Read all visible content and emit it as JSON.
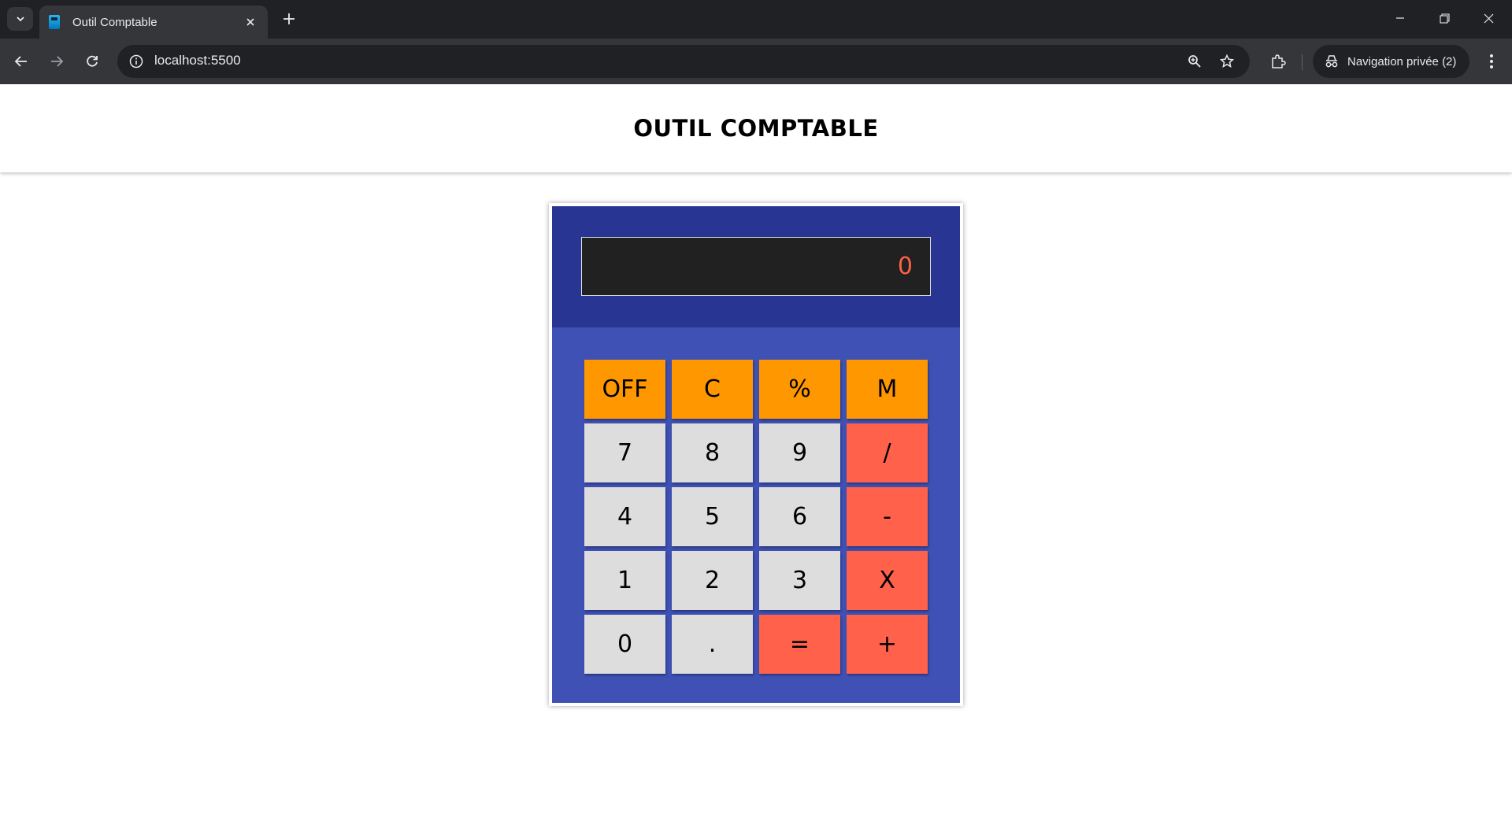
{
  "browser": {
    "tab_title": "Outil Comptable",
    "url": "localhost:5500",
    "private_label": "Navigation privée (2)"
  },
  "page": {
    "title": "OUTIL COMPTABLE"
  },
  "calculator": {
    "display": "0",
    "keys": [
      {
        "label": "OFF",
        "kind": "orange"
      },
      {
        "label": "C",
        "kind": "orange"
      },
      {
        "label": "%",
        "kind": "orange"
      },
      {
        "label": "M",
        "kind": "orange"
      },
      {
        "label": "7",
        "kind": "gray"
      },
      {
        "label": "8",
        "kind": "gray"
      },
      {
        "label": "9",
        "kind": "gray"
      },
      {
        "label": "/",
        "kind": "red"
      },
      {
        "label": "4",
        "kind": "gray"
      },
      {
        "label": "5",
        "kind": "gray"
      },
      {
        "label": "6",
        "kind": "gray"
      },
      {
        "label": "-",
        "kind": "red"
      },
      {
        "label": "1",
        "kind": "gray"
      },
      {
        "label": "2",
        "kind": "gray"
      },
      {
        "label": "3",
        "kind": "gray"
      },
      {
        "label": "X",
        "kind": "red"
      },
      {
        "label": "0",
        "kind": "gray"
      },
      {
        "label": ".",
        "kind": "gray"
      },
      {
        "label": "=",
        "kind": "red"
      },
      {
        "label": "+",
        "kind": "red"
      }
    ],
    "colors": {
      "body": "#3f51b5",
      "top": "#283593",
      "screen": "#212121",
      "screen_text": "#ff6148",
      "function_keys": "#ff9800",
      "digit_keys": "#dddddd",
      "operator_keys": "#ff614b"
    }
  }
}
